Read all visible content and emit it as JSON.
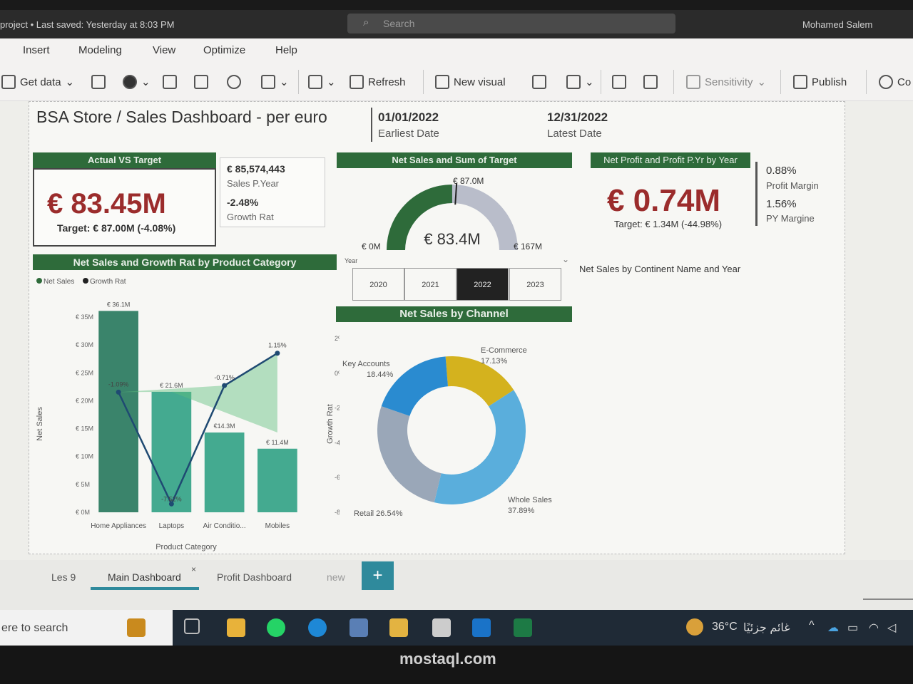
{
  "titlebar": {
    "doc_status": "project • Last saved: Yesterday at 8:03 PM",
    "search_placeholder": "Search",
    "user_name": "Mohamed Salem"
  },
  "menu": {
    "items": [
      "Insert",
      "Modeling",
      "View",
      "Optimize",
      "Help"
    ]
  },
  "ribbon": {
    "get_data": "Get data",
    "refresh": "Refresh",
    "new_visual": "New visual",
    "sensitivity": "Sensitivity",
    "publish": "Publish",
    "copilot_partial": "Co"
  },
  "report": {
    "title": "BSA Store / Sales Dashboard - per euro",
    "earliest_date_value": "01/01/2022",
    "earliest_date_label": "Earliest Date",
    "latest_date_value": "12/31/2022",
    "latest_date_label": "Latest Date"
  },
  "actual_vs_target": {
    "header": "Actual VS Target",
    "value": "€ 83.45M",
    "target": "Target: € 87.00M (-4.08%)",
    "sales_py_value": "€ 85,574,443",
    "sales_py_label": "Sales P.Year",
    "growth_value": "-2.48%",
    "growth_label": "Growth Rat"
  },
  "gauge": {
    "header": "Net Sales and Sum of Target",
    "value": "€ 83.4M",
    "min": "€ 0M",
    "max": "€ 167M",
    "target": "€ 87.0M",
    "value_fraction": 0.4997,
    "target_fraction": 0.521
  },
  "profit": {
    "header": "Net Profit and Profit P.Yr by Year",
    "value": "€ 0.74M",
    "target": "Target: € 1.34M (-44.98%)",
    "margin_value": "0.88%",
    "margin_label": "Profit Margin",
    "py_margin_value": "1.56%",
    "py_margin_label": "PY Margine"
  },
  "year_slicer": {
    "label": "Year",
    "options": [
      "2020",
      "2021",
      "2022",
      "2023"
    ],
    "selected": "2022"
  },
  "continent_title": "Net Sales by Continent Name and Year",
  "chart_data": [
    {
      "type": "bar",
      "title": "Net Sales and Growth Rat by Product Category",
      "legend": [
        "Net Sales",
        "Growth Rat"
      ],
      "xlabel": "Product Category",
      "ylabel": "Net Sales",
      "y2label": "Growth Rat",
      "categories": [
        "Home Appliances",
        "Laptops",
        "Air Conditio...",
        "Mobiles"
      ],
      "yticks": [
        "€ 0M",
        "€ 5M",
        "€ 10M",
        "€ 15M",
        "€ 20M",
        "€ 25M",
        "€ 30M",
        "€ 35M"
      ],
      "y2ticks": [
        "-8%",
        "-6%",
        "-4%",
        "-2%",
        "0%",
        "2%"
      ],
      "ylim": [
        0,
        35
      ],
      "y2lim": [
        -8,
        2
      ],
      "series": [
        {
          "name": "Net Sales",
          "kind": "bar",
          "values": [
            36.1,
            21.6,
            14.3,
            11.4
          ],
          "labels": [
            "€ 36.1M",
            "€ 21.6M",
            "€14.3M",
            "€ 11.4M"
          ]
        },
        {
          "name": "Growth Rat",
          "kind": "line",
          "values": [
            -1.09,
            -7.52,
            -0.71,
            1.15
          ],
          "labels": [
            "-1.09%",
            "-7.52%",
            "-0.71%",
            "1.15%"
          ]
        }
      ],
      "colors": {
        "bar": "#3a8f6e",
        "line": "#1f4a72"
      }
    },
    {
      "type": "pie",
      "title": "Net Sales by Channel",
      "categories": [
        "E-Commerce",
        "Whole Sales",
        "Retail",
        "Key Accounts"
      ],
      "values": [
        17.13,
        37.89,
        26.54,
        18.44
      ],
      "labels": [
        "E-Commerce 17.13%",
        "Whole Sales 37.89%",
        "Retail 26.54%",
        "Key Accounts 18.44%"
      ],
      "colors": [
        "#d4b21e",
        "#5aaedc",
        "#9aa7b8",
        "#2a8bd0"
      ]
    }
  ],
  "tabs": {
    "items": [
      "Les 9",
      "Main Dashboard",
      "Profit Dashboard",
      "new"
    ],
    "active": "Main Dashboard",
    "add": "+"
  },
  "taskbar": {
    "search": "ere to search",
    "temperature": "36°C",
    "weather_text": "غائم جزئيًا"
  },
  "watermark": "mostaql.com"
}
